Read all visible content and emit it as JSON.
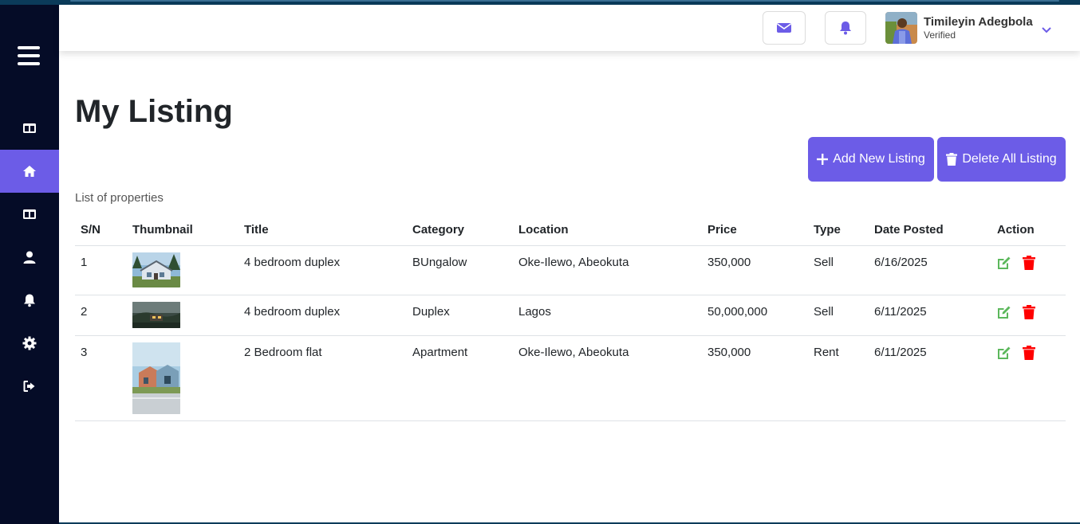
{
  "header": {
    "user_name": "Timileyin Adegbola",
    "user_status": "Verified"
  },
  "page": {
    "title": "My Listing",
    "subtitle": "List of properties",
    "add_button": "Add New Listing",
    "delete_all_button": "Delete All Listing"
  },
  "colors": {
    "accent": "#6c5ce7",
    "sidebar": "#050c27",
    "edit": "#5cb85c",
    "delete": "#ff0000"
  },
  "sidebar": {
    "items": [
      {
        "icon": "dashboard-icon"
      },
      {
        "icon": "home-icon",
        "active": true
      },
      {
        "icon": "listing-icon"
      },
      {
        "icon": "user-icon"
      },
      {
        "icon": "bell-icon"
      },
      {
        "icon": "gear-icon"
      },
      {
        "icon": "logout-icon"
      }
    ]
  },
  "table": {
    "columns": [
      "S/N",
      "Thumbnail",
      "Title",
      "Category",
      "Location",
      "Price",
      "Type",
      "Date Posted",
      "Action"
    ],
    "rows": [
      {
        "sn": "1",
        "title": "4 bedroom duplex",
        "category": "BUngalow",
        "location": "Oke-Ilewo, Abeokuta",
        "price": "350,000",
        "type": "Sell",
        "date": "6/16/2025"
      },
      {
        "sn": "2",
        "title": "4 bedroom duplex",
        "category": "Duplex",
        "location": "Lagos",
        "price": "50,000,000",
        "type": "Sell",
        "date": "6/11/2025"
      },
      {
        "sn": "3",
        "title": "2 Bedroom flat",
        "category": "Apartment",
        "location": "Oke-Ilewo, Abeokuta",
        "price": "350,000",
        "type": "Rent",
        "date": "6/11/2025"
      }
    ]
  }
}
